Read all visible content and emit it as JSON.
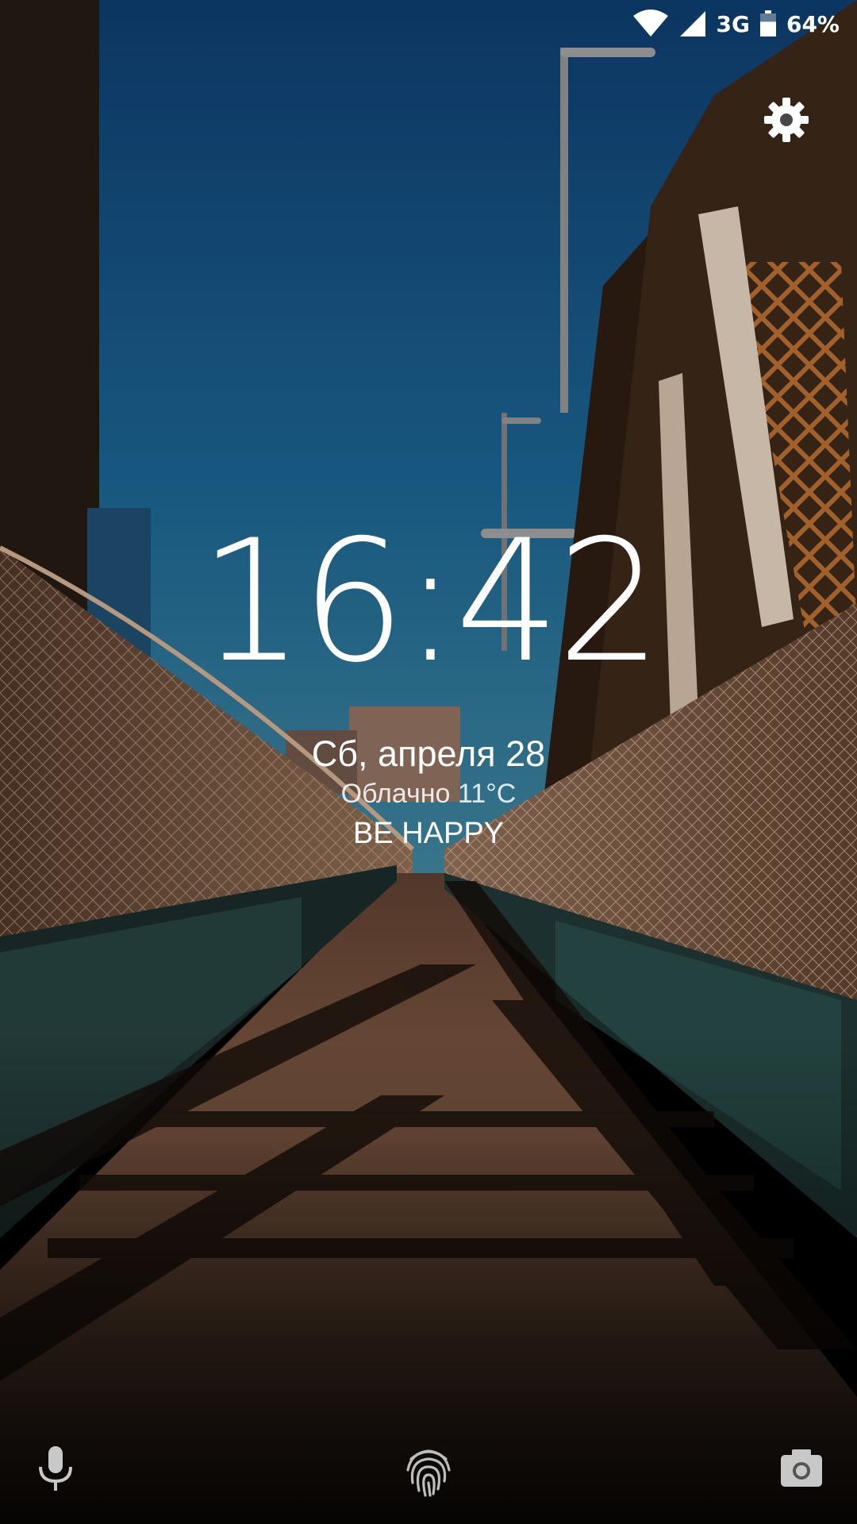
{
  "status_bar": {
    "network": "3G",
    "battery": "64%",
    "battery_level": 0.64,
    "icons": [
      "wifi-icon",
      "cell-signal-icon",
      "battery-icon"
    ]
  },
  "lockscreen": {
    "time": "16:42",
    "date": "Сб, апреля 28",
    "weather": "Облачно 11°C",
    "owner_message": "BE HAPPY"
  },
  "shortcuts": {
    "left": "microphone-icon",
    "center": "fingerprint-icon",
    "right": "camera-icon",
    "settings": "gear-icon"
  },
  "colors": {
    "sky": "#14507a",
    "deck": "#6e4a36",
    "shadow": "#1a120e",
    "rust": "#9a5c2a",
    "text": "#ffffff"
  }
}
